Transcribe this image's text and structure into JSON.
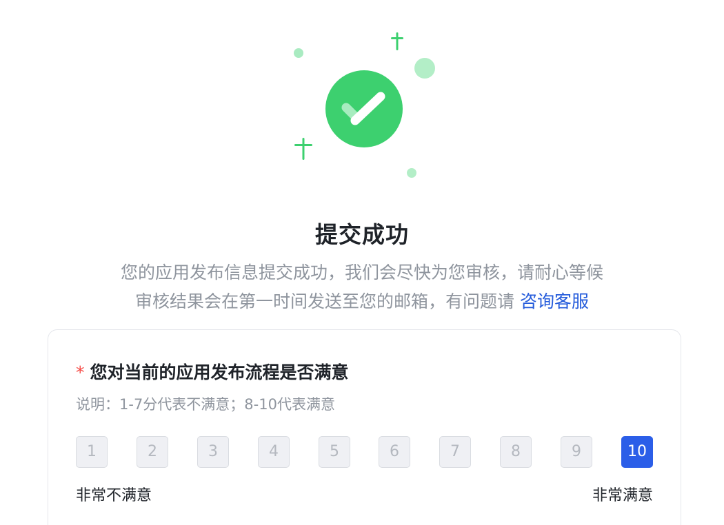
{
  "illustration": {
    "icon": "success-check-icon",
    "accent_color": "#3dd06f",
    "decoration_color": "#b3eec7"
  },
  "result": {
    "title": "提交成功",
    "description_line1": "您的应用发布信息提交成功，我们会尽快为您审核，请耐心等候",
    "description_line2": "审核结果会在第一时间发送至您的邮箱，有问题请",
    "support_link": "咨询客服",
    "link_color": "#245bdb"
  },
  "survey": {
    "required_mark": "*",
    "question": "您对当前的应用发布流程是否满意",
    "note": "说明：1-7分代表不满意；8-10代表满意",
    "scores": [
      "1",
      "2",
      "3",
      "4",
      "5",
      "6",
      "7",
      "8",
      "9",
      "10"
    ],
    "selected_score": "10",
    "selected_color": "#2b5ee8",
    "label_low": "非常不满意",
    "label_high": "非常满意"
  }
}
